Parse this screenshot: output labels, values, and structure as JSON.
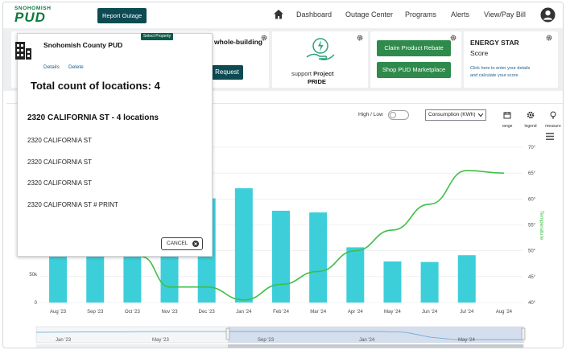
{
  "nav": {
    "logo_top": "SNOHOMISH",
    "logo_main": "PUD",
    "report_outage": "Report Outage",
    "links": [
      "Dashboard",
      "Outage Center",
      "Programs",
      "Alerts",
      "View/Pay Bill"
    ]
  },
  "cards": {
    "whole_building": "whole-building",
    "request": "Request",
    "support_prefix": "support",
    "support_project": "Project",
    "pride": "PRIDE",
    "claim_rebate": "Claim Product Rebate",
    "shop_marketplace": "Shop PUD Marketplace",
    "energy_star_title": "ENERGY STAR",
    "energy_star_sub": "Score",
    "energy_star_desc_1": "Click here to enter your details",
    "energy_star_desc_2": "and calculate your score"
  },
  "controls": {
    "high_low": "High / Low",
    "select_value": "Consumption (KWh)",
    "tools": [
      "range",
      "legend",
      "measure"
    ]
  },
  "popup": {
    "tag": "Select Property",
    "org": "Snohomish County PUD",
    "details": "Details",
    "delete": "Delete",
    "total": "Total count of locations: 4",
    "group": "2320 CALIFORNIA ST - 4 locations",
    "items": [
      "2320 CALIFORNIA ST",
      "2320 CALIFORNIA ST",
      "2320 CALIFORNIA ST",
      "2320 CALIFORNIA ST # PRINT"
    ],
    "cancel": "CANCEL"
  },
  "colors": {
    "bar": "#3ccfda",
    "line": "#3dbf45",
    "brand_green": "#0a7a3e",
    "dark_teal": "#0d4a52",
    "button_green": "#2f8a4c"
  },
  "chart_data": {
    "type": "bar",
    "categories": [
      "Aug '23",
      "Sep '23",
      "Oct '23",
      "Nov '23",
      "Dec '23",
      "Jan '24",
      "Feb '24",
      "Mar '24",
      "Apr '24",
      "May '24",
      "Jun '24",
      "Jul '24",
      "Aug '24"
    ],
    "series": [
      {
        "values": [
          null,
          null,
          null,
          null,
          185,
          203,
          163,
          160,
          98,
          73,
          72,
          84,
          null
        ]
      },
      {
        "values": [
          null,
          null,
          null,
          43,
          43,
          40.5,
          43.5,
          46,
          50,
          54,
          59,
          65.5,
          65
        ]
      }
    ],
    "y_left_ticks": [
      "0",
      "50k"
    ],
    "y_right_label": "Temperature",
    "y_right_ticks": [
      "40°",
      "45°",
      "50°",
      "55°",
      "60°",
      "65°",
      "70°"
    ],
    "y_right_lim": [
      40,
      72
    ],
    "navigator_labels": [
      "Jan '23",
      "May '23",
      "Sep '23",
      "Jan '24",
      "May '24"
    ]
  }
}
